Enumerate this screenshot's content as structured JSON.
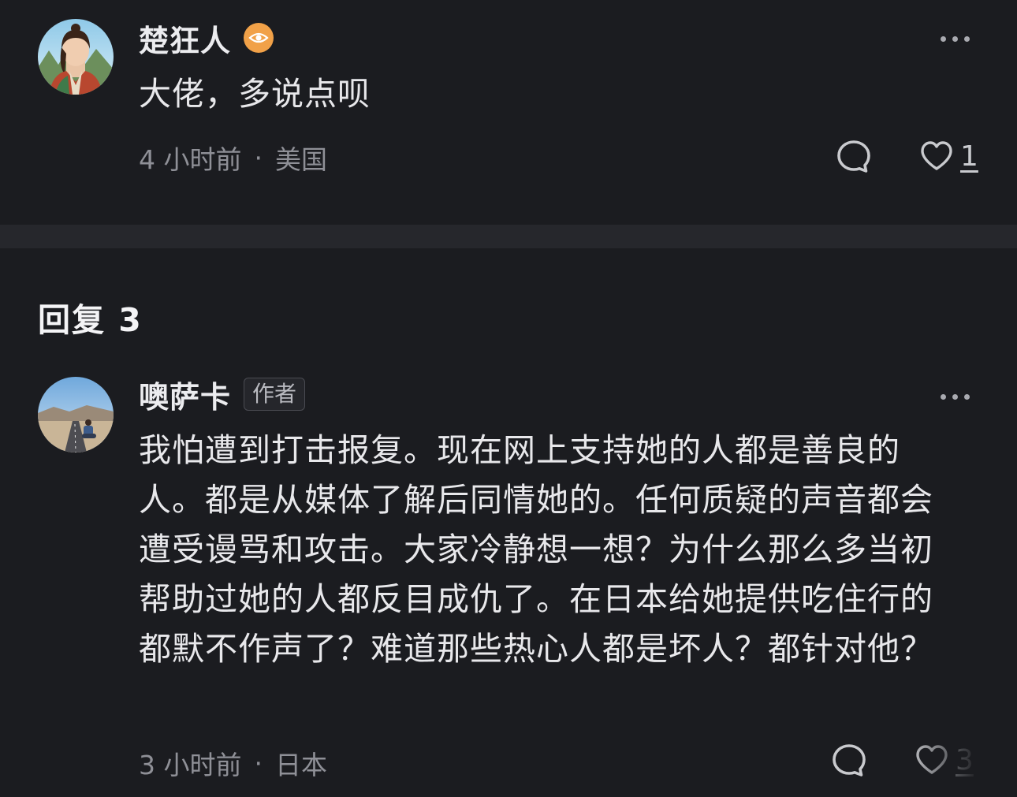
{
  "comments": [
    {
      "username": "楚狂人",
      "badge_icon": "eye-icon",
      "badge_color": "#f1a148",
      "text": "大佬，多说点呗",
      "time": "4 小时前",
      "location": "美国",
      "like_count": "1"
    },
    {
      "username": "噢萨卡",
      "author_tag": "作者",
      "text": "我怕遭到打击报复。现在网上支持她的人都是善良的人。都是从媒体了解后同情她的。任何质疑的声音都会遭受谩骂和攻击。大家冷静想一想？为什么那么多当初帮助过她的人都反目成仇了。在日本给她提供吃住行的都默不作声了？难道那些热心人都是坏人？都针对他？",
      "time": "3 小时前",
      "location": "日本",
      "like_count": "3"
    }
  ],
  "replies_header": {
    "label": "回复 3"
  },
  "separator": "·",
  "icons": {
    "more": "more-dots-icon",
    "comment": "comment-bubble-icon",
    "like": "heart-icon"
  }
}
